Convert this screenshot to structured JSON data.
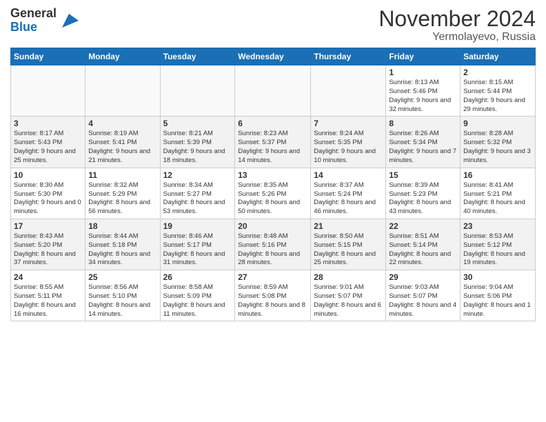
{
  "logo": {
    "general": "General",
    "blue": "Blue"
  },
  "title": "November 2024",
  "location": "Yermolayevo, Russia",
  "days_of_week": [
    "Sunday",
    "Monday",
    "Tuesday",
    "Wednesday",
    "Thursday",
    "Friday",
    "Saturday"
  ],
  "weeks": [
    [
      {
        "day": "",
        "info": ""
      },
      {
        "day": "",
        "info": ""
      },
      {
        "day": "",
        "info": ""
      },
      {
        "day": "",
        "info": ""
      },
      {
        "day": "",
        "info": ""
      },
      {
        "day": "1",
        "info": "Sunrise: 8:13 AM\nSunset: 5:46 PM\nDaylight: 9 hours and 32 minutes."
      },
      {
        "day": "2",
        "info": "Sunrise: 8:15 AM\nSunset: 5:44 PM\nDaylight: 9 hours and 29 minutes."
      }
    ],
    [
      {
        "day": "3",
        "info": "Sunrise: 8:17 AM\nSunset: 5:43 PM\nDaylight: 9 hours and 25 minutes."
      },
      {
        "day": "4",
        "info": "Sunrise: 8:19 AM\nSunset: 5:41 PM\nDaylight: 9 hours and 21 minutes."
      },
      {
        "day": "5",
        "info": "Sunrise: 8:21 AM\nSunset: 5:39 PM\nDaylight: 9 hours and 18 minutes."
      },
      {
        "day": "6",
        "info": "Sunrise: 8:23 AM\nSunset: 5:37 PM\nDaylight: 9 hours and 14 minutes."
      },
      {
        "day": "7",
        "info": "Sunrise: 8:24 AM\nSunset: 5:35 PM\nDaylight: 9 hours and 10 minutes."
      },
      {
        "day": "8",
        "info": "Sunrise: 8:26 AM\nSunset: 5:34 PM\nDaylight: 9 hours and 7 minutes."
      },
      {
        "day": "9",
        "info": "Sunrise: 8:28 AM\nSunset: 5:32 PM\nDaylight: 9 hours and 3 minutes."
      }
    ],
    [
      {
        "day": "10",
        "info": "Sunrise: 8:30 AM\nSunset: 5:30 PM\nDaylight: 9 hours and 0 minutes."
      },
      {
        "day": "11",
        "info": "Sunrise: 8:32 AM\nSunset: 5:29 PM\nDaylight: 8 hours and 56 minutes."
      },
      {
        "day": "12",
        "info": "Sunrise: 8:34 AM\nSunset: 5:27 PM\nDaylight: 8 hours and 53 minutes."
      },
      {
        "day": "13",
        "info": "Sunrise: 8:35 AM\nSunset: 5:26 PM\nDaylight: 8 hours and 50 minutes."
      },
      {
        "day": "14",
        "info": "Sunrise: 8:37 AM\nSunset: 5:24 PM\nDaylight: 8 hours and 46 minutes."
      },
      {
        "day": "15",
        "info": "Sunrise: 8:39 AM\nSunset: 5:23 PM\nDaylight: 8 hours and 43 minutes."
      },
      {
        "day": "16",
        "info": "Sunrise: 8:41 AM\nSunset: 5:21 PM\nDaylight: 8 hours and 40 minutes."
      }
    ],
    [
      {
        "day": "17",
        "info": "Sunrise: 8:43 AM\nSunset: 5:20 PM\nDaylight: 8 hours and 37 minutes."
      },
      {
        "day": "18",
        "info": "Sunrise: 8:44 AM\nSunset: 5:18 PM\nDaylight: 8 hours and 34 minutes."
      },
      {
        "day": "19",
        "info": "Sunrise: 8:46 AM\nSunset: 5:17 PM\nDaylight: 8 hours and 31 minutes."
      },
      {
        "day": "20",
        "info": "Sunrise: 8:48 AM\nSunset: 5:16 PM\nDaylight: 8 hours and 28 minutes."
      },
      {
        "day": "21",
        "info": "Sunrise: 8:50 AM\nSunset: 5:15 PM\nDaylight: 8 hours and 25 minutes."
      },
      {
        "day": "22",
        "info": "Sunrise: 8:51 AM\nSunset: 5:14 PM\nDaylight: 8 hours and 22 minutes."
      },
      {
        "day": "23",
        "info": "Sunrise: 8:53 AM\nSunset: 5:12 PM\nDaylight: 8 hours and 19 minutes."
      }
    ],
    [
      {
        "day": "24",
        "info": "Sunrise: 8:55 AM\nSunset: 5:11 PM\nDaylight: 8 hours and 16 minutes."
      },
      {
        "day": "25",
        "info": "Sunrise: 8:56 AM\nSunset: 5:10 PM\nDaylight: 8 hours and 14 minutes."
      },
      {
        "day": "26",
        "info": "Sunrise: 8:58 AM\nSunset: 5:09 PM\nDaylight: 8 hours and 11 minutes."
      },
      {
        "day": "27",
        "info": "Sunrise: 8:59 AM\nSunset: 5:08 PM\nDaylight: 8 hours and 8 minutes."
      },
      {
        "day": "28",
        "info": "Sunrise: 9:01 AM\nSunset: 5:07 PM\nDaylight: 8 hours and 6 minutes."
      },
      {
        "day": "29",
        "info": "Sunrise: 9:03 AM\nSunset: 5:07 PM\nDaylight: 8 hours and 4 minutes."
      },
      {
        "day": "30",
        "info": "Sunrise: 9:04 AM\nSunset: 5:06 PM\nDaylight: 8 hours and 1 minute."
      }
    ]
  ]
}
